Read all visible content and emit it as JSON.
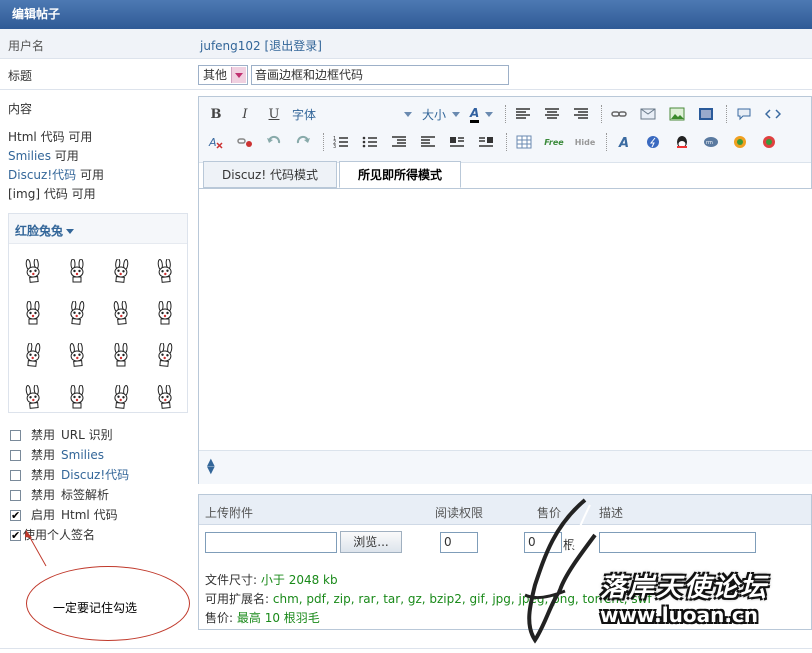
{
  "header": {
    "title": "编辑帖子"
  },
  "user": {
    "label": "用户名",
    "name": "jufeng102",
    "logout": "退出登录"
  },
  "title_row": {
    "label": "标题",
    "category": "其他",
    "value": "音画边框和边框代码"
  },
  "left": {
    "content_label": "内容",
    "codes": [
      {
        "name": "Html 代码",
        "state": "可用"
      },
      {
        "name": "Smilies",
        "state": "可用"
      },
      {
        "name": "Discuz!代码",
        "state": "可用"
      },
      {
        "name": "[img] 代码",
        "state": "可用"
      }
    ],
    "smiley_set": "红脸兔兔",
    "options": [
      {
        "prefix": "禁用",
        "label": "URL 识别",
        "checked": false
      },
      {
        "prefix": "禁用",
        "label": "Smilies",
        "checked": false
      },
      {
        "prefix": "禁用",
        "label": "Discuz!代码",
        "checked": false
      },
      {
        "prefix": "禁用",
        "label": "标签解析",
        "checked": false
      },
      {
        "prefix": "启用",
        "label": "Html 代码",
        "checked": true
      },
      {
        "prefix": "",
        "label": "使用个人签名",
        "checked": true
      }
    ],
    "annotation": "一定要记住勾选"
  },
  "toolbar": {
    "bold": "B",
    "italic": "I",
    "underline": "U",
    "font_label": "字体",
    "size_label": "大小",
    "color_label": "A",
    "free_label": "Free",
    "hide_label": "Hide"
  },
  "tabs": [
    "Discuz! 代码模式",
    "所见即所得模式"
  ],
  "attachments": {
    "headers": {
      "upload": "上传附件",
      "permission": "阅读权限",
      "price": "售价",
      "desc": "描述"
    },
    "browse_label": "浏览...",
    "permission_value": "0",
    "price_value": "0",
    "price_unit": "根",
    "size_label": "文件尺寸:",
    "size_value": "小于  2048 kb",
    "ext_label": "可用扩展名:",
    "ext_value": "chm, pdf, zip, rar, tar, gz, bzip2, gif, jpg, jpeg, png, torrent, swf",
    "price_info_label": "售价:",
    "price_info_value": "最高  10 根羽毛"
  },
  "watermark": {
    "title": "落岸天使论坛",
    "url": "www.luoan.cn"
  },
  "colors": {
    "header": "#2f5a96",
    "link": "#336699",
    "green": "#1a8a1a",
    "annotation": "#c0392b"
  }
}
